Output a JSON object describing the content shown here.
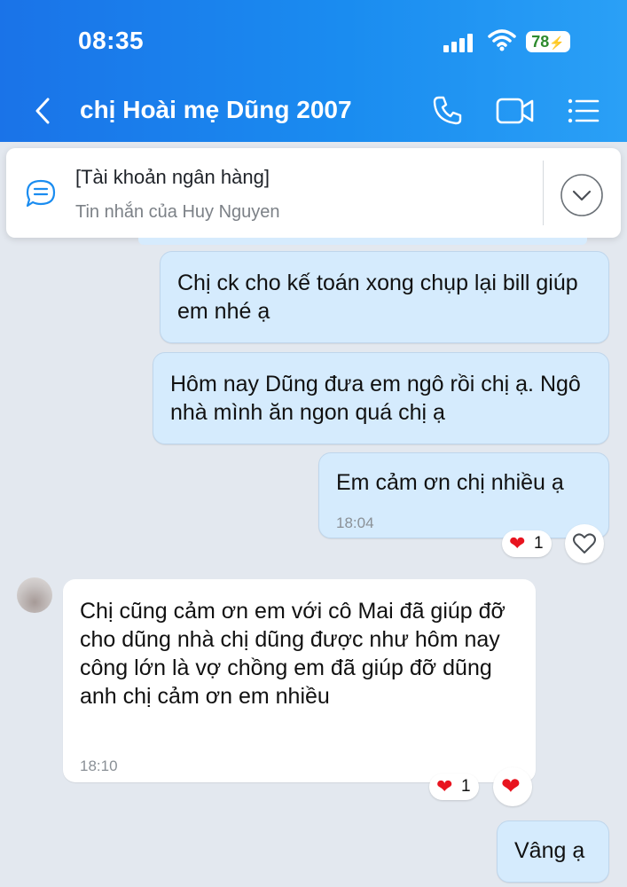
{
  "status_bar": {
    "time": "08:35",
    "battery": "78"
  },
  "header": {
    "title": "chị Hoài mẹ Dũng 2007"
  },
  "pinned": {
    "title": "[Tài khoản ngân hàng]",
    "subtitle": "Tin nhắn của Huy Nguyen"
  },
  "messages": [
    {
      "direction": "out",
      "text": "Chị ck cho kế toán xong chụp lại bill giúp em nhé ạ"
    },
    {
      "direction": "out",
      "text": "Hôm nay Dũng đưa em ngô rồi chị ạ. Ngô nhà mình ăn ngon quá chị ạ"
    },
    {
      "direction": "out",
      "text": "Em cảm ơn chị nhiều ạ",
      "time": "18:04",
      "reaction_count": "1"
    },
    {
      "direction": "in",
      "text": "Chị cũng cảm ơn em với cô Mai đã giúp đỡ cho dũng nhà chị dũng được như hôm nay công lớn là vợ chồng em đã giúp đỡ dũng anh chị cảm ơn em nhiều",
      "time": "18:10",
      "reaction_count": "1"
    },
    {
      "direction": "out",
      "text": "Vâng ạ"
    }
  ],
  "colors": {
    "header": "#1a8cf0",
    "outgoing_bubble": "#d5ebfd",
    "background": "#e3e8ef",
    "heart": "#e8141f"
  },
  "icons": [
    "back-chevron-icon",
    "phone-icon",
    "video-icon",
    "menu-list-icon",
    "pinned-message-icon",
    "chevron-down-icon",
    "heart-icon",
    "heart-outline-icon",
    "signal-icon",
    "wifi-icon",
    "battery-icon"
  ]
}
